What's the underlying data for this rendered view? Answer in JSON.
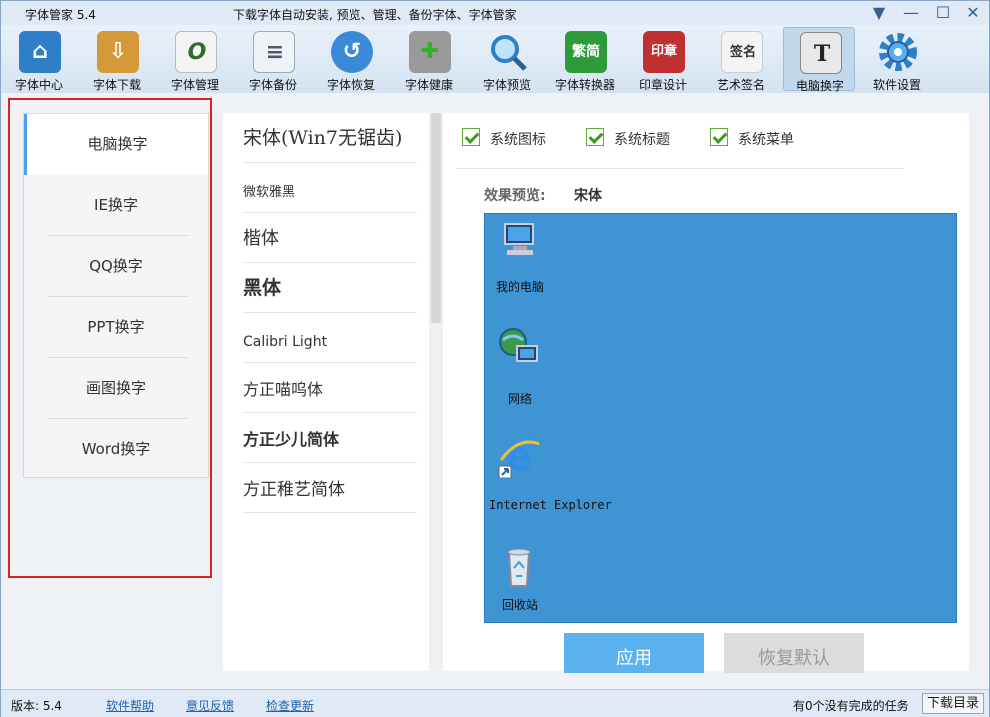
{
  "window": {
    "title": "字体管家 5.4",
    "slogan": "下载字体自动安装, 预览、管理、备份字体、字体管家",
    "controls": {
      "menu": "▼",
      "minimize": "—",
      "maximize": "☐",
      "close": "✕"
    }
  },
  "toolbar": {
    "items": [
      {
        "label": "字体中心",
        "icon": "house-icon",
        "color": "#2f7fc8"
      },
      {
        "label": "字体下载",
        "icon": "download-box-icon",
        "color": "#d49a3a"
      },
      {
        "label": "字体管理",
        "icon": "font-manage-icon",
        "color": "#5aa03a"
      },
      {
        "label": "字体备份",
        "icon": "document-icon",
        "color": "#8aa6c4"
      },
      {
        "label": "字体恢复",
        "icon": "restore-icon",
        "color": "#3a8ad8"
      },
      {
        "label": "字体健康",
        "icon": "first-aid-kit-icon",
        "color": "#888888"
      },
      {
        "label": "字体预览",
        "icon": "magnifier-icon",
        "color": "#3a9ad8"
      },
      {
        "label": "字体转换器",
        "icon": "converter-icon",
        "color": "#2f9a3a"
      },
      {
        "label": "印章设计",
        "icon": "seal-icon",
        "color": "#c03030"
      },
      {
        "label": "艺术签名",
        "icon": "signature-icon",
        "color": "#b0b0b0"
      },
      {
        "label": "电脑换字",
        "icon": "font-t-icon",
        "color": "#506070"
      },
      {
        "label": "软件设置",
        "icon": "gear-icon",
        "color": "#2f7fc8"
      }
    ],
    "active_index": 10
  },
  "left_menu": {
    "items": [
      "电脑换字",
      "IE换字",
      "QQ换字",
      "PPT换字",
      "画图换字",
      "Word换字"
    ],
    "active_index": 0
  },
  "font_list": [
    "宋体(Win7无锯齿)",
    "微软雅黑",
    "楷体",
    "黑体",
    "Calibri Light",
    "方正喵呜体",
    "方正少儿简体",
    "方正稚艺简体"
  ],
  "options": {
    "checkboxes": [
      {
        "label": "系统图标",
        "checked": true
      },
      {
        "label": "系统标题",
        "checked": true
      },
      {
        "label": "系统菜单",
        "checked": true
      }
    ],
    "preview_label": "效果预览:",
    "preview_font": "宋体"
  },
  "desktop_icons": [
    {
      "label": "我的电脑",
      "icon": "computer-icon"
    },
    {
      "label": "网络",
      "icon": "network-icon"
    },
    {
      "label": "Internet Explorer",
      "icon": "ie-icon"
    },
    {
      "label": "回收站",
      "icon": "recycle-bin-icon"
    }
  ],
  "actions": {
    "apply": "应用",
    "reset": "恢复默认"
  },
  "statusbar": {
    "version": "版本: 5.4",
    "links": [
      "软件帮助",
      "意见反馈",
      "检查更新"
    ],
    "tasks": "有0个没有完成的任务",
    "download_dir": "下载目录"
  }
}
